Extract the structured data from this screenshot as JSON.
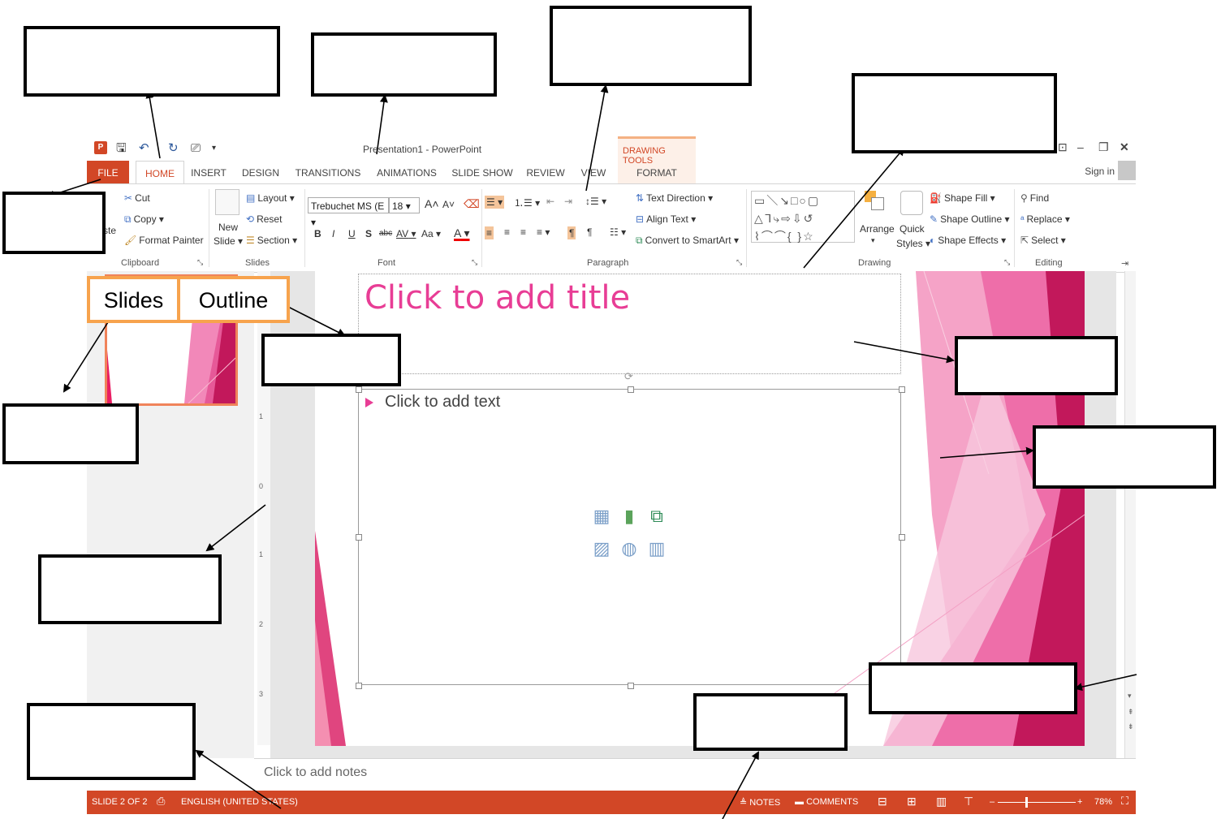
{
  "window": {
    "title": "Presentation1 - PowerPoint",
    "contextual_group": "DRAWING TOOLS"
  },
  "tabs": [
    "FILE",
    "HOME",
    "INSERT",
    "DESIGN",
    "TRANSITIONS",
    "ANIMATIONS",
    "SLIDE SHOW",
    "REVIEW",
    "VIEW",
    "FORMAT"
  ],
  "signin": "Sign in",
  "clipboard": {
    "paste": "ste",
    "cut": "Cut",
    "copy": "Copy",
    "format_painter": "Format Painter",
    "label": "Clipboard"
  },
  "slides_group": {
    "new_slide_1": "New",
    "new_slide_2": "Slide",
    "layout": "Layout",
    "reset": "Reset",
    "section": "Section",
    "label": "Slides"
  },
  "font_group": {
    "font_name": "Trebuchet MS (E",
    "font_size": "18",
    "label": "Font",
    "bold": "B",
    "italic": "I",
    "underline": "U",
    "shadow": "S",
    "strike": "abc",
    "spacing": "AV",
    "case": "Aa",
    "color": "A"
  },
  "paragraph_group": {
    "text_direction": "Text Direction",
    "align_text": "Align Text",
    "smartart": "Convert to SmartArt",
    "label": "Paragraph"
  },
  "drawing_group": {
    "arrange": "Arrange",
    "quick_styles_1": "Quick",
    "quick_styles_2": "Styles",
    "shape_fill": "Shape Fill",
    "shape_outline": "Shape Outline",
    "shape_effects": "Shape Effects",
    "label": "Drawing"
  },
  "editing_group": {
    "find": "Find",
    "replace": "Replace",
    "select": "Select",
    "label": "Editing"
  },
  "slide": {
    "title_placeholder": "Click to add title",
    "body_placeholder": "Click to add text"
  },
  "notes": "Click to add notes",
  "ruler_ticks": [
    "1",
    "0",
    "1",
    "2",
    "3"
  ],
  "statusbar": {
    "slide": "SLIDE 2 OF 2",
    "language": "ENGLISH (UNITED STATES)",
    "notes": "NOTES",
    "comments": "COMMENTS",
    "zoom": "78%"
  },
  "pane_tabs": {
    "slides": "Slides",
    "outline": "Outline"
  },
  "colors": {
    "accent": "#d24726",
    "title_pink": "#e83d95",
    "tab_box_border": "#f7a34d"
  }
}
